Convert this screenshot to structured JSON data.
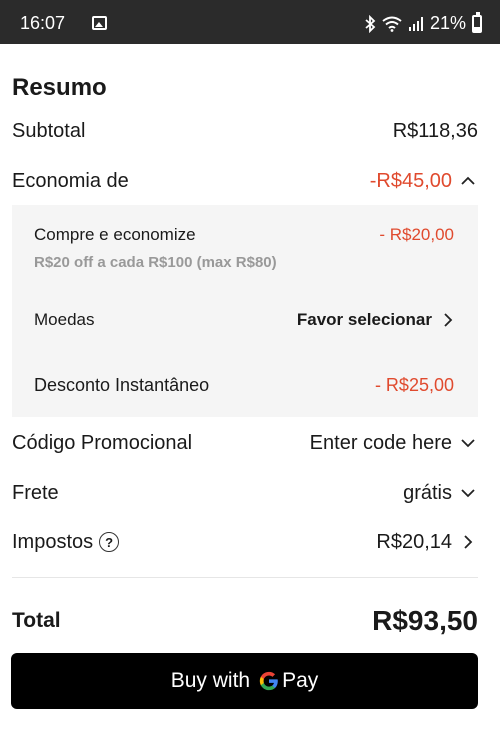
{
  "status_bar": {
    "time": "16:07",
    "battery": "21%"
  },
  "summary": {
    "title": "Resumo",
    "subtotal_label": "Subtotal",
    "subtotal_value": "R$118,36",
    "savings_label": "Economia de",
    "savings_value": "-R$45,00",
    "savings_details": {
      "buy_save_label": "Compre e economize",
      "buy_save_value": "- R$20,00",
      "buy_save_desc": "R$20 off a cada R$100 (max R$80)",
      "coins_label": "Moedas",
      "coins_value": "Favor selecionar",
      "instant_label": "Desconto Instantâneo",
      "instant_value": "- R$25,00"
    },
    "promo_label": "Código Promocional",
    "promo_value": "Enter code here",
    "shipping_label": "Frete",
    "shipping_value": "grátis",
    "taxes_label": "Impostos",
    "taxes_help": "?",
    "taxes_value": "R$20,14",
    "total_label": "Total",
    "total_value": "R$93,50"
  },
  "gpay_button": {
    "prefix": "Buy with",
    "suffix": "Pay"
  },
  "colors": {
    "accent_red": "#e04a2e",
    "button_bg": "#000000"
  }
}
